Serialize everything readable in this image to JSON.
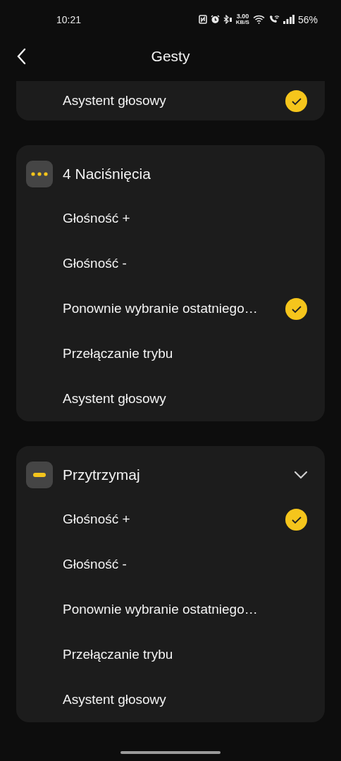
{
  "status_bar": {
    "time": "10:21",
    "speed_value": "3.00",
    "speed_unit": "KB/S",
    "battery": "56%"
  },
  "header": {
    "title": "Gesty"
  },
  "sections": [
    {
      "options": [
        {
          "label": "Asystent głosowy",
          "selected": true
        }
      ]
    },
    {
      "title": "4 Naciśnięcia",
      "kind": "dots",
      "chevron": false,
      "options": [
        {
          "label": "Głośność +",
          "selected": false
        },
        {
          "label": "Głośność -",
          "selected": false
        },
        {
          "label": "Ponownie wybranie ostatniego…",
          "selected": true
        },
        {
          "label": "Przełączanie trybu",
          "selected": false
        },
        {
          "label": "Asystent głosowy",
          "selected": false
        }
      ]
    },
    {
      "title": "Przytrzymaj",
      "kind": "bar",
      "chevron": true,
      "options": [
        {
          "label": "Głośność +",
          "selected": true
        },
        {
          "label": "Głośność -",
          "selected": false
        },
        {
          "label": "Ponownie wybranie ostatniego…",
          "selected": false
        },
        {
          "label": "Przełączanie trybu",
          "selected": false
        },
        {
          "label": "Asystent głosowy",
          "selected": false
        }
      ]
    }
  ]
}
